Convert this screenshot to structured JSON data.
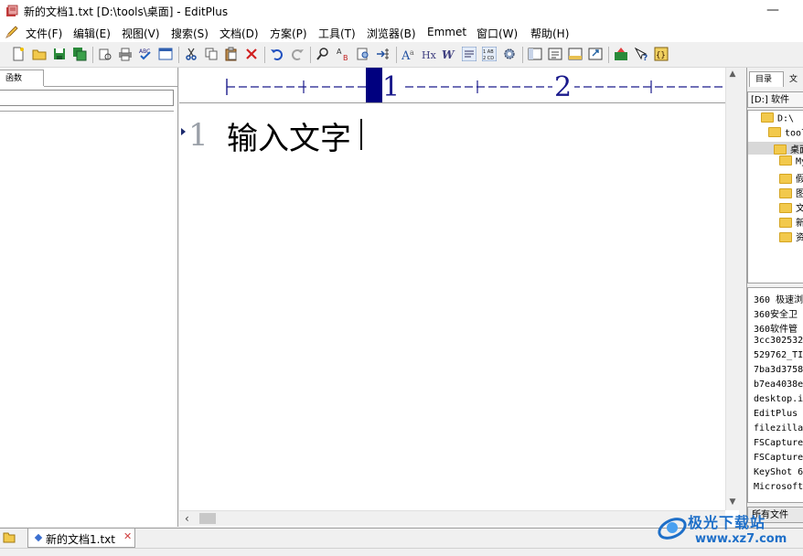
{
  "window": {
    "title": "新的文档1.txt [D:\\tools\\桌面] - EditPlus",
    "minimize_glyph": "—"
  },
  "menu": {
    "items": [
      "文件(F)",
      "编辑(E)",
      "视图(V)",
      "搜索(S)",
      "文档(D)",
      "方案(P)",
      "工具(T)",
      "浏览器(B)",
      "Emmet",
      "窗口(W)",
      "帮助(H)"
    ]
  },
  "toolbar": {
    "icons": [
      "new-file-icon",
      "open-folder-icon",
      "save-icon",
      "save-all-icon",
      "print-preview-icon",
      "print-icon",
      "spellcheck-icon",
      "browser-preview-icon",
      "cut-icon",
      "copy-icon",
      "paste-icon",
      "delete-icon",
      "undo-icon",
      "redo-icon",
      "find-icon",
      "replace-icon",
      "find-in-files-icon",
      "goto-line-icon",
      "font-icon",
      "hx-icon",
      "word-wrap-icon",
      "ruler-icon",
      "line-number-icon",
      "settings-icon",
      "directory-window-icon",
      "cliptext-window-icon",
      "output-window-icon",
      "fullscreen-icon",
      "ftp-upload-icon",
      "help-icon",
      "brackets-icon"
    ]
  },
  "left_panel": {
    "tab_label": "函数"
  },
  "editor": {
    "ruler": {
      "marks": [
        "1",
        "2"
      ]
    },
    "line_number": "1",
    "text": "输入文字"
  },
  "right_panel": {
    "tabs": [
      "目录",
      "文"
    ],
    "drive": "[D:] 软件",
    "tree": [
      {
        "label": "D:\\",
        "level": 0
      },
      {
        "label": "tools",
        "level": 1
      },
      {
        "label": "桌面",
        "level": 2,
        "selected": true
      },
      {
        "label": "My",
        "level": 3
      },
      {
        "label": "假",
        "level": 3
      },
      {
        "label": "图",
        "level": 3
      },
      {
        "label": "文",
        "level": 3
      },
      {
        "label": "新",
        "level": 3
      },
      {
        "label": "资",
        "level": 3
      }
    ],
    "files": [
      "360 极速浏",
      "360安全卫",
      "360软件管",
      "3cc302532",
      "529762_TI",
      "7ba3d3758",
      "b7ea4038e",
      "desktop.i",
      "EditPlus",
      "filezilla",
      "FSCapture",
      "FSCapture",
      "KeyShot 6",
      "Microsoft"
    ],
    "filter": "所有文件"
  },
  "doc_tabs": [
    {
      "label": "新的文档1.txt",
      "close_glyph": "✕"
    }
  ],
  "watermark": {
    "line1": "极光下载站",
    "line2": "www.xz7.com"
  },
  "colors": {
    "ruler_highlight": "#00007f",
    "ruler_ink": "#1a1a8c",
    "folder": "#f2c94c",
    "watermark": "#1e6fc8"
  }
}
